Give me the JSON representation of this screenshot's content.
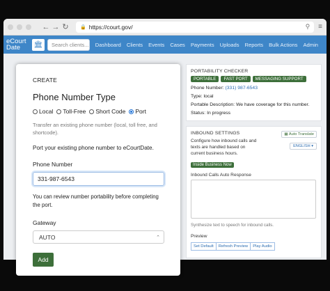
{
  "browser": {
    "url": "https://court.gov/"
  },
  "nav": {
    "logo": "eCourt Date",
    "search_placeholder": "Search clients...",
    "links": [
      "Dashboard",
      "Clients",
      "Events",
      "Cases",
      "Payments",
      "Uploads",
      "Reports",
      "Bulk Actions",
      "Admin"
    ]
  },
  "form": {
    "section": "CREATE",
    "title": "Phone Number Type",
    "options": [
      "Local",
      "Toll-Free",
      "Short Code",
      "Port"
    ],
    "selected": "Port",
    "hint": "Transfer an existing phone number (local, toll free, and shortcode).",
    "port_text": "Port your existing phone number to eCourtDate.",
    "phone_label": "Phone Number",
    "phone_value": "331-987-6543",
    "review_text": "You can review number portability before completing the port.",
    "gateway_label": "Gateway",
    "gateway_value": "AUTO",
    "add_label": "Add"
  },
  "checker": {
    "title": "PORTABILITY CHECKER",
    "badges": [
      "PORTABLE",
      "FAST PORT",
      "MESSAGING SUPPORT"
    ],
    "phone_label": "Phone Number:",
    "phone_value": "(331) 987-6543",
    "type_label": "Type:",
    "type_value": "local",
    "desc_label": "Portable Description:",
    "desc_value": "We have coverage for this number.",
    "status_label": "Status:",
    "status_value": "In progress"
  },
  "inbound": {
    "title": "INBOUND SETTINGS",
    "description": "Configure how inbound calls and texts are handled based on current business hours.",
    "auto_translate": "Auto Translate",
    "language": "ENGLISH",
    "business_badge": "Inside Business Now",
    "response_label": "Inbound Calls Auto Response",
    "synth_text": "Synthesize text to speech for inbound calls.",
    "preview_label": "Preview",
    "buttons": [
      "Set Default",
      "Refresh Preview",
      "Play Audio"
    ]
  }
}
